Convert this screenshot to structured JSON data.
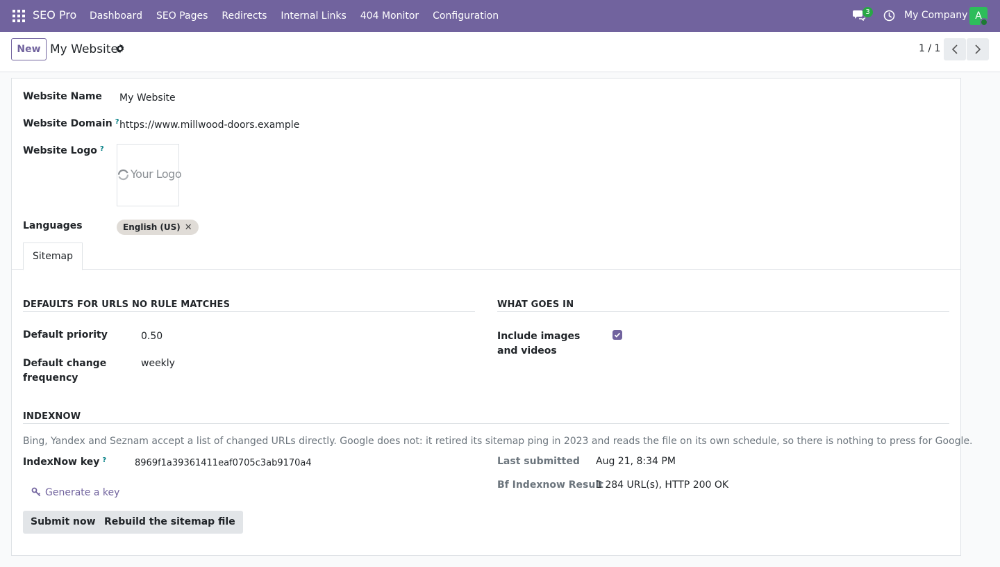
{
  "navbar": {
    "brand": "SEO Pro",
    "menu": [
      "Dashboard",
      "SEO Pages",
      "Redirects",
      "Internal Links",
      "404 Monitor",
      "Configuration"
    ],
    "chat_count": "3",
    "company": "My Company",
    "avatar_initial": "A",
    "colors": {
      "bar": "#71639e",
      "avatar": "#2dbd5a",
      "badge": "#28a745"
    }
  },
  "control": {
    "new_label": "New",
    "record_title": "My Website",
    "pager": "1 / 1"
  },
  "form": {
    "website_name_label": "Website Name",
    "website_name": "My Website",
    "website_domain_label": "Website Domain",
    "website_domain": "https://www.millwood-doors.example",
    "website_logo_label": "Website Logo",
    "logo_text": "Your Logo",
    "languages_label": "Languages",
    "language_tag": "English (US)",
    "help_mark": "?"
  },
  "tabs": [
    "Sitemap"
  ],
  "sitemap": {
    "defaults_title": "Defaults for URLs no rule matches",
    "default_priority_label": "Default priority",
    "default_priority": "0.50",
    "default_change_frequency_label": "Default change frequency",
    "default_change_frequency": "weekly",
    "what_goes_in_title": "What goes in",
    "include_media_label": "Include images and videos",
    "include_media_checked": true
  },
  "indexnow": {
    "title": "IndexNow",
    "description": "Bing, Yandex and Seznam accept a list of changed URLs directly. Google does not: it retired its sitemap ping in 2023 and reads the file on its own schedule, so there is nothing to press for Google.",
    "key_label": "IndexNow key",
    "key_value": "8969f1a39361411eaf0705c3ab9170a4",
    "last_submitted_label": "Last submitted",
    "last_submitted": "Aug 21, 8:34 PM",
    "result_label": "Bf Indexnow Result",
    "result": "1 284 URL(s), HTTP 200 OK",
    "generate_key_label": "Generate a key",
    "submit_label": "Submit now",
    "rebuild_label": "Rebuild the sitemap file"
  }
}
